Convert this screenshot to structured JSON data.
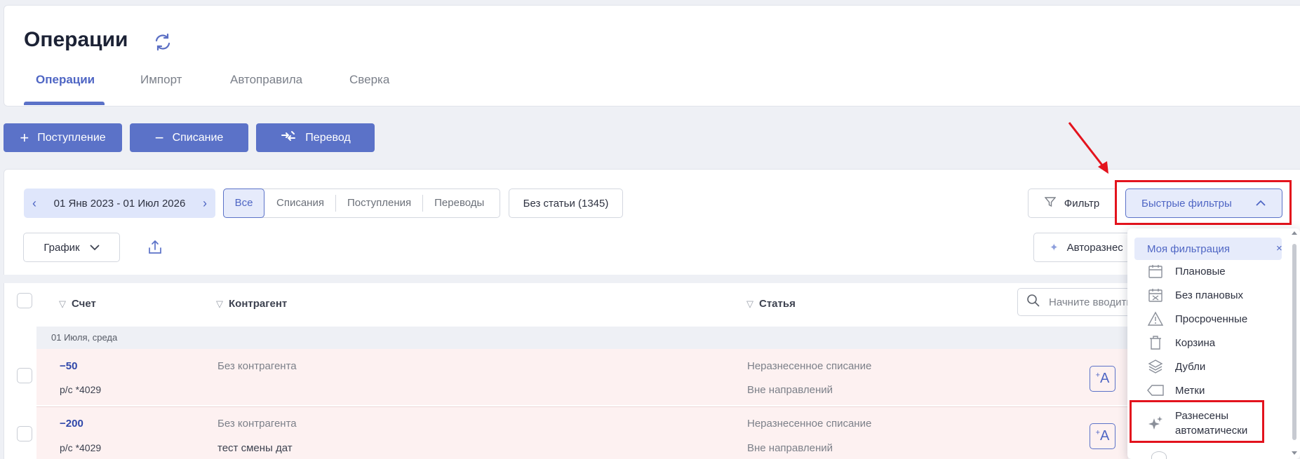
{
  "header": {
    "title": "Операции"
  },
  "tabs": [
    {
      "label": "Операции",
      "active": true
    },
    {
      "label": "Импорт",
      "active": false
    },
    {
      "label": "Автоправила",
      "active": false
    },
    {
      "label": "Сверка",
      "active": false
    }
  ],
  "actions": {
    "income": {
      "icon": "plus-icon",
      "label": "Поступление"
    },
    "expense": {
      "icon": "minus-icon",
      "label": "Списание"
    },
    "transfer": {
      "icon": "transfer-icon",
      "label": "Перевод"
    }
  },
  "toolbar": {
    "date_range": "01 Янв 2023 - 01 Июл 2026",
    "segments": [
      "Все",
      "Списания",
      "Поступления",
      "Переводы"
    ],
    "selected_segment": "Все",
    "no_article": "Без статьи (1345)",
    "filter_label": "Фильтр",
    "quick_filters_label": "Быстрые фильтры",
    "chart_label": "График",
    "auto_label": "Авторазнес"
  },
  "dropdown": {
    "my_filter": "Моя фильтрация",
    "close": "×",
    "items": [
      {
        "label": "Плановые",
        "icon": "calendar-icon"
      },
      {
        "label": "Без плановых",
        "icon": "calendar-x-icon"
      },
      {
        "label": "Просроченные",
        "icon": "warning-icon"
      },
      {
        "label": "Корзина",
        "icon": "trash-icon"
      },
      {
        "label": "Дубли",
        "icon": "layers-icon"
      },
      {
        "label": "Метки",
        "icon": "tag-icon"
      },
      {
        "label": "Разнесены автоматически",
        "line1": "Разнесены",
        "line2": "автоматически",
        "icon": "sparkle-icon"
      }
    ]
  },
  "table": {
    "columns": {
      "account": "Счет",
      "counterparty": "Контрагент",
      "article": "Статья"
    },
    "search_placeholder": "Начните вводить",
    "group_label": "01 Июля, среда",
    "rows": [
      {
        "amount": "−50",
        "account": "р/с *4029",
        "counterparty": "Без контрагента",
        "counterparty_note": "",
        "article": "Неразнесенное списание",
        "direction": "Вне направлений"
      },
      {
        "amount": "−200",
        "account": "р/с *4029",
        "counterparty": "Без контрагента",
        "counterparty_note": "тест смены дат",
        "article": "Неразнесенное списание",
        "direction": "Вне направлений"
      }
    ]
  },
  "colors": {
    "accent": "#5b72c8",
    "highlight": "#e3131d",
    "row_bg": "#fdf1f1"
  }
}
